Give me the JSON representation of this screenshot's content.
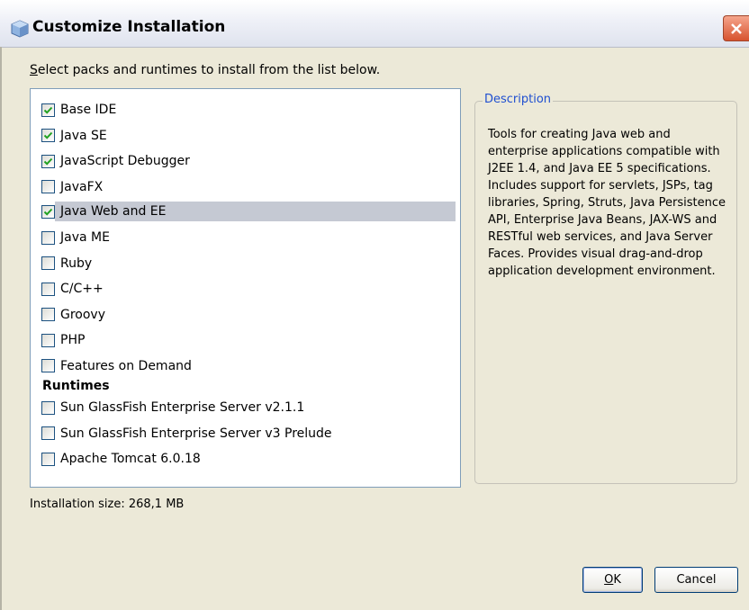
{
  "window": {
    "title": "Customize Installation"
  },
  "instruction": {
    "underlined_char": "S",
    "rest": "elect packs and runtimes to install from the list below."
  },
  "packs": [
    {
      "label": "Base IDE",
      "checked": true
    },
    {
      "label": "Java SE",
      "checked": true
    },
    {
      "label": "JavaScript Debugger",
      "checked": true
    },
    {
      "label": "JavaFX",
      "checked": false
    },
    {
      "label": "Java Web and EE",
      "checked": true,
      "selected": true
    },
    {
      "label": "Java ME",
      "checked": false
    },
    {
      "label": "Ruby",
      "checked": false
    },
    {
      "label": "C/C++",
      "checked": false
    },
    {
      "label": "Groovy",
      "checked": false
    },
    {
      "label": "PHP",
      "checked": false
    },
    {
      "label": "Features on Demand",
      "checked": false
    }
  ],
  "runtimes_heading": "Runtimes",
  "runtimes": [
    {
      "label": "Sun GlassFish Enterprise Server v2.1.1",
      "checked": false
    },
    {
      "label": "Sun GlassFish Enterprise Server v3 Prelude",
      "checked": false
    },
    {
      "label": "Apache Tomcat 6.0.18",
      "checked": false
    }
  ],
  "description": {
    "legend": "Description",
    "text": "Tools for creating Java web and enterprise applications compatible with J2EE 1.4, and Java EE 5 specifications. Includes support for servlets, JSPs, tag libraries, Spring, Struts, Java Persistence API, Enterprise Java Beans, JAX-WS and RESTful web services, and Java Server Faces. Provides visual drag-and-drop application development environment."
  },
  "installation_size": "Installation size: 268,1 MB",
  "buttons": {
    "ok_underlined": "O",
    "ok_rest": "K",
    "cancel": "Cancel"
  },
  "colors": {
    "window_bg": "#ece9d8",
    "selection": "#c5c9d3",
    "legend": "#1f4fd0",
    "close_button": "#d7532f"
  },
  "icons": {
    "window": "netbeans-cube-icon",
    "close": "close-icon",
    "checkmark": "checkmark-icon"
  }
}
